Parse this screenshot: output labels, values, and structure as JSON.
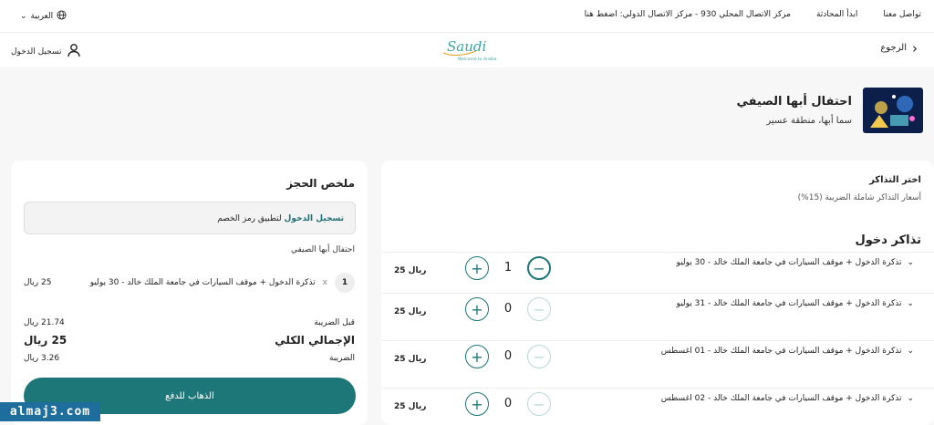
{
  "topbar": {
    "language": "العربية",
    "contact": "تواصل معنا",
    "chat": "ابدأ المحادثة",
    "call_center": "مركز الاتصال المحلي 930  - مركز الاتصال الدولي: اضغط هنا"
  },
  "navbar": {
    "back": "الرجوع",
    "login": "تسجيل الدخول",
    "logo_text": "Saudi",
    "logo_sub": "Welcome to Arabia"
  },
  "event": {
    "title": "احتفال أبها الصيفي",
    "location": "سما أبها، منطقة عسير"
  },
  "summary": {
    "title": "ملخص الحجز",
    "coupon_link": "تسجيل الدخول",
    "coupon_text": " لتطبيق رمز الخصم",
    "event_name": "احتفال أبها الصيفي",
    "item_qty": "1",
    "item_x": "x",
    "item_label": "تذكرة الدخول + موقف السيارات في جامعة الملك خالد - 30 يوليو",
    "item_price": "25 ريال",
    "pre_tax_label": "قبل الضريبة",
    "pre_tax_value": "21.74 ريال",
    "total_label": "الإجمالي الكلي",
    "total_value": "25 ريال",
    "tax_label": "الضريبة",
    "tax_value": "3.26 ريال",
    "pay_button": "الذهاب للدفع"
  },
  "tickets": {
    "choose": "اختر التذاكر",
    "tax_note": "أسعار التذاكر شاملة الضريبة (15%)",
    "section_title": "تذاكر دخول",
    "rows": [
      {
        "label": "تذكرة الدخول + موقف السيارات في جامعة الملك خالد - 30 يوليو",
        "qty": "1",
        "price": "25 ريال"
      },
      {
        "label": "تذكرة الدخول + موقف السيارات في جامعة الملك خالد - 31 يوليو",
        "qty": "0",
        "price": "25 ريال"
      },
      {
        "label": "تذكرة الدخول + موقف السيارات في جامعة الملك خالد - 01 اغسطس",
        "qty": "0",
        "price": "25 ريال"
      },
      {
        "label": "تذكرة الدخول + موقف السيارات في جامعة الملك خالد - 02 اغسطس",
        "qty": "0",
        "price": "25 ريال"
      }
    ]
  },
  "watermark": "almaj3.com",
  "colors": {
    "accent": "#1d7677",
    "watermark_bg": "#1d6d9d"
  }
}
